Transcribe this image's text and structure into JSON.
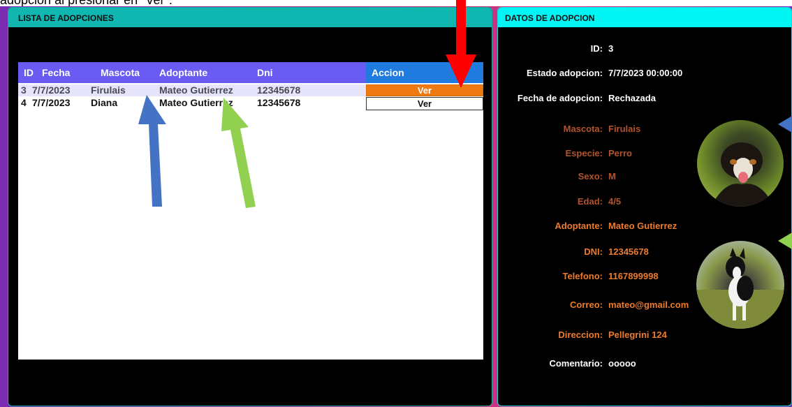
{
  "caption": "adopcion al presionar en \"Ver\".",
  "left_panel": {
    "title": "LISTA DE ADOPCIONES",
    "columns": [
      "ID",
      "Fecha",
      "Mascota",
      "Adoptante",
      "Dni",
      "Accion"
    ],
    "rows": [
      {
        "id": "3",
        "fecha": "7/7/2023",
        "mascota": "Firulais",
        "adoptante": "Mateo Gutierrez",
        "dni": "12345678",
        "accion": "Ver"
      },
      {
        "id": "4",
        "fecha": "7/7/2023",
        "mascota": "Diana",
        "adoptante": "Mateo Gutierrez",
        "dni": "12345678",
        "accion": "Ver"
      }
    ]
  },
  "right_panel": {
    "title": "DATOS DE ADOPCION",
    "fields": [
      {
        "label": "ID:",
        "value": "3"
      },
      {
        "label": "Estado adopcion:",
        "value": "7/7/2023 00:00:00"
      },
      {
        "label": "Fecha de adopcion:",
        "value": "Rechazada"
      },
      {
        "label": "Mascota:",
        "value": "Firulais"
      },
      {
        "label": "Especie:",
        "value": "Perro"
      },
      {
        "label": "Sexo:",
        "value": "M"
      },
      {
        "label": "Edad:",
        "value": "4/5"
      },
      {
        "label": "Adoptante:",
        "value": "Mateo Gutierrez"
      },
      {
        "label": "DNI:",
        "value": "12345678"
      },
      {
        "label": "Telefono:",
        "value": "1167899998"
      },
      {
        "label": "Correo:",
        "value": "mateo@gmail.com"
      },
      {
        "label": "Direccion:",
        "value": "Pellegrini 124"
      },
      {
        "label": "Comentario:",
        "value": "ooooo"
      }
    ]
  },
  "colors": {
    "left_header": "#0fb7b0",
    "right_header": "#00f5f5",
    "grid_header": "#6a5cf2",
    "accion_header": "#1f7be0",
    "ver_selected": "#f07a12",
    "pet_text": "#b3542c",
    "adopter_text": "#ee7b2c",
    "arrow_red": "#ff0000",
    "arrow_blue": "#4472c4",
    "arrow_green": "#92d050"
  }
}
